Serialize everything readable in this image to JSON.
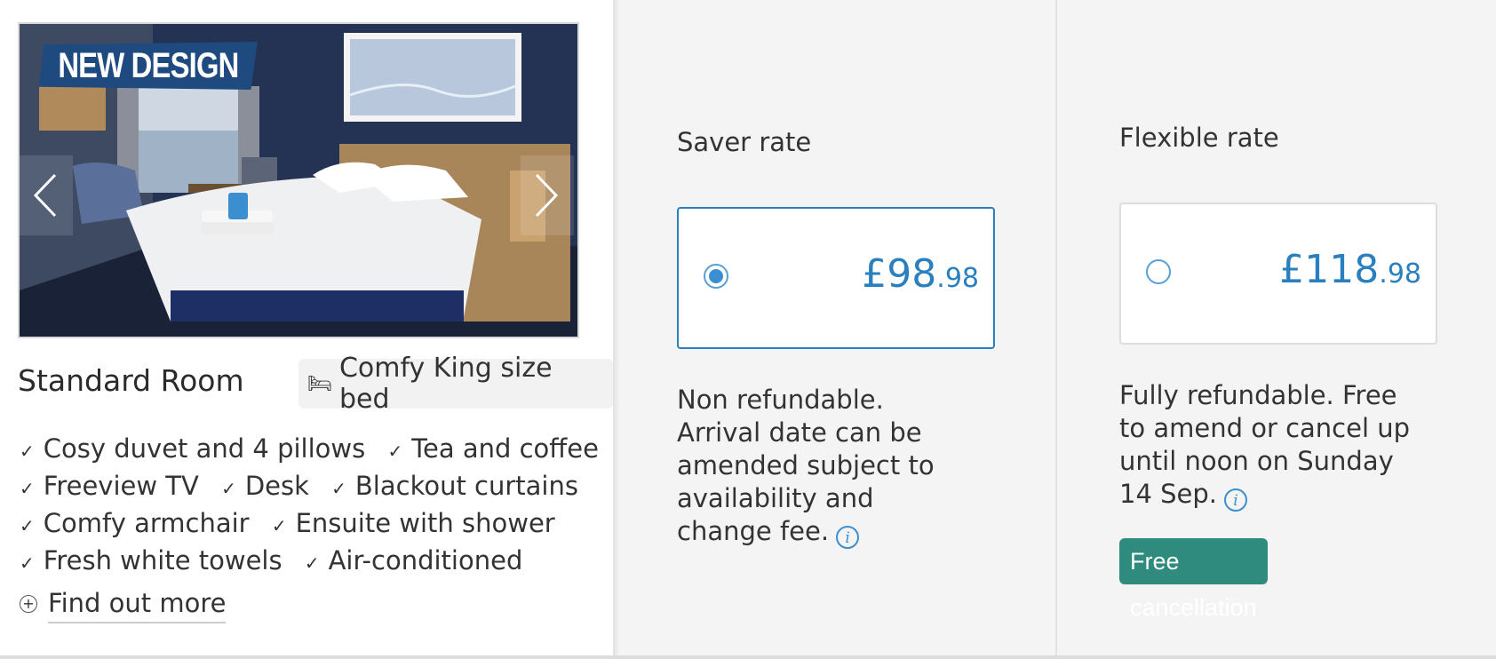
{
  "room": {
    "badge": "NEW DESIGN",
    "name": "Standard Room",
    "bed_icon": "bed-icon",
    "bed_label": "Comfy King size bed",
    "features": [
      [
        "Cosy duvet and 4 pillows",
        "Tea and coffee"
      ],
      [
        "Freeview TV",
        "Desk",
        "Blackout curtains"
      ],
      [
        "Comfy armchair",
        "Ensuite with shower"
      ],
      [
        "Fresh white towels",
        "Air-conditioned"
      ]
    ],
    "find_more": "Find out more"
  },
  "rates": [
    {
      "title": "Saver rate",
      "price_main": "£98",
      "price_pence": ".98",
      "selected": true,
      "description": "Non refundable. Arrival date can be amended subject to availability and change fee."
    },
    {
      "title": "Flexible rate",
      "price_main": "£118",
      "price_pence": ".98",
      "selected": false,
      "description": "Fully refundable. Free to amend or cancel up until noon on Sunday 14 Sep.",
      "badge": "Free cancellation"
    }
  ],
  "colors": {
    "accent": "#2a7fbf",
    "badge_green": "#2f8b7d",
    "new_design_blue": "#1e4a80",
    "panel_bg": "#f4f4f4"
  }
}
